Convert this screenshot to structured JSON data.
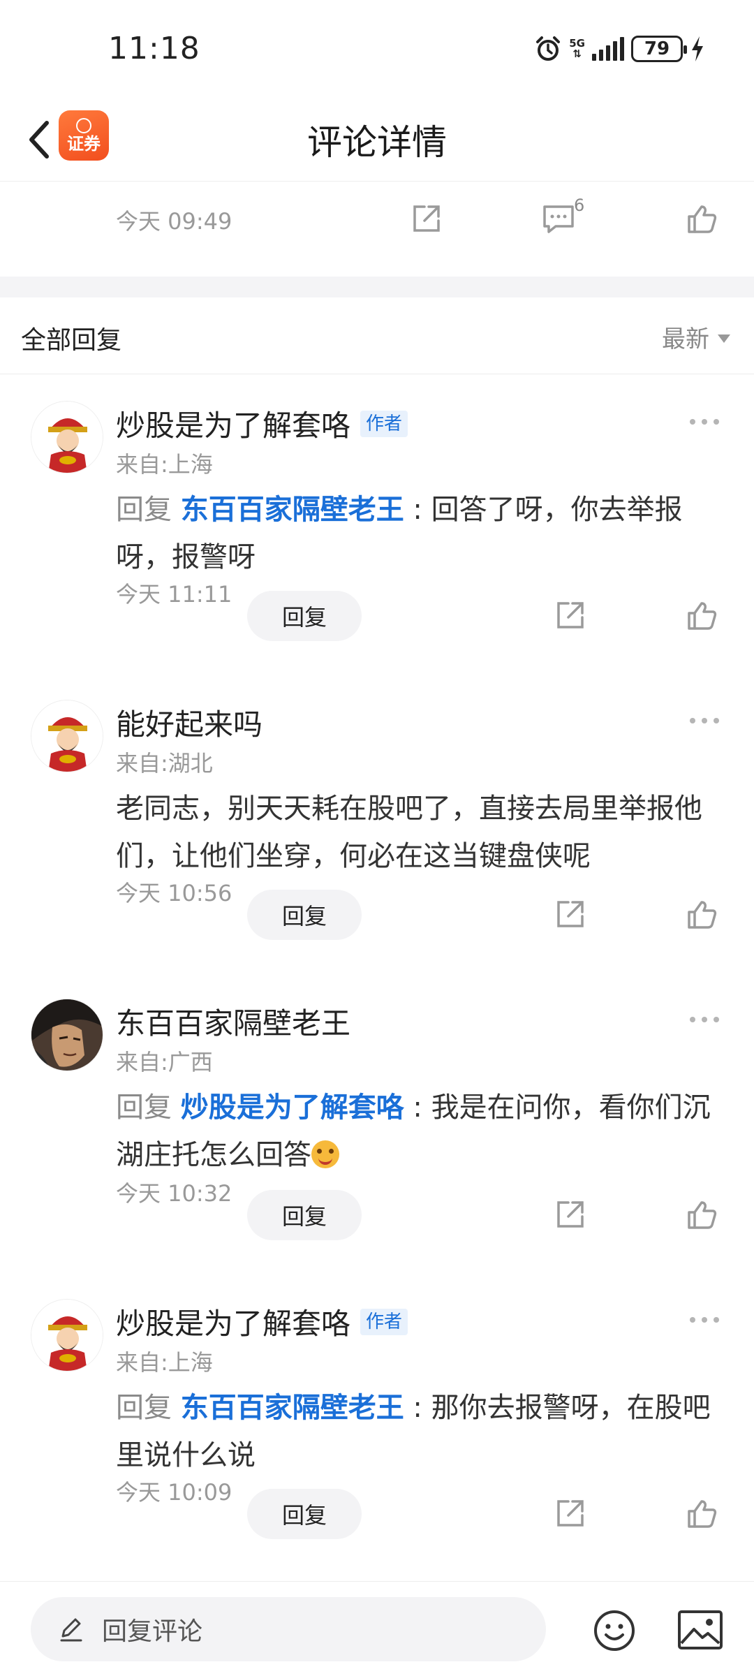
{
  "status_bar": {
    "time": "11:18",
    "network": "5G",
    "battery": "79"
  },
  "header": {
    "title": "评论详情",
    "app_badge": "证券"
  },
  "top_comment": {
    "time": "今天 09:49",
    "comment_count": "6"
  },
  "replies_section": {
    "label": "全部回复",
    "sort": "最新"
  },
  "replies": [
    {
      "author": "炒股是为了解套咯",
      "badge": "作者",
      "location": "来自:上海",
      "prefix": "回复 ",
      "target": "东百百家隔壁老王",
      "colon": " : ",
      "text": "回答了呀，你去举报呀，报警呀",
      "time": "今天 11:11",
      "reply_label": "回复"
    },
    {
      "author": "能好起来吗",
      "location": "来自:湖北",
      "text": "老同志，别天天耗在股吧了，直接去局里举报他们，让他们坐穿，何必在这当键盘侠呢",
      "time": "今天 10:56",
      "reply_label": "回复"
    },
    {
      "author": "东百百家隔壁老王",
      "location": "来自:广西",
      "prefix": "回复 ",
      "target": "炒股是为了解套咯",
      "colon": " : ",
      "text": "我是在问你，看你们沉湖庄托怎么回答",
      "time": "今天 10:32",
      "reply_label": "回复"
    },
    {
      "author": "炒股是为了解套咯",
      "badge": "作者",
      "location": "来自:上海",
      "prefix": "回复 ",
      "target": "东百百家隔壁老王",
      "colon": " : ",
      "text": "那你去报警呀，在股吧里说什么说",
      "time": "今天 10:09",
      "reply_label": "回复"
    }
  ],
  "bottom_bar": {
    "placeholder": "回复评论"
  },
  "colors": {
    "link_blue": "#1a6fd8",
    "logo_orange": "#f24e1e",
    "muted_gray": "#999999"
  }
}
